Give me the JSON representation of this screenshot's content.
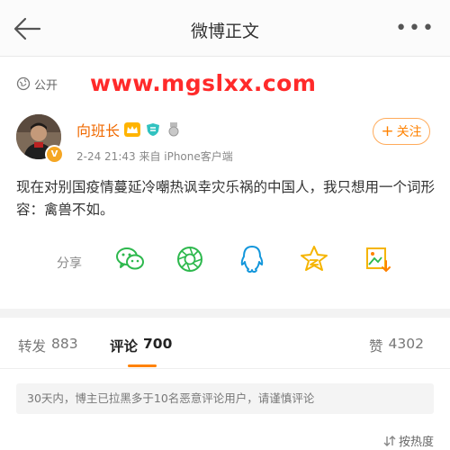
{
  "header": {
    "title": "微博正文",
    "more": "•••"
  },
  "post": {
    "visibility": "公开",
    "watermark": "www.mgslxx.com",
    "author": {
      "name": "向班长",
      "verified_badge": "V"
    },
    "meta": "2-24 21:43  来自 iPhone客户端",
    "follow_label": "关注",
    "text": "现在对别国疫情蔓延冷嘲热讽幸灾乐祸的中国人，我只想用一个词形容：禽兽不如。"
  },
  "share": {
    "label": "分享",
    "icons": [
      "wechat-icon",
      "moments-icon",
      "qq-icon",
      "qzone-icon",
      "image-share-icon"
    ]
  },
  "tabs": {
    "repost": {
      "label": "转发",
      "count": "883"
    },
    "comment": {
      "label": "评论",
      "count": "700"
    },
    "like": {
      "label": "赞",
      "count": "4302"
    }
  },
  "notice": "30天内，博主已拉黑多于10名恶意评论用户，请谨慎评论",
  "sort_label": "按热度",
  "colors": {
    "accent": "#ff8200",
    "username": "#f06900",
    "watermark": "#ff2a2a",
    "share_green": "#2db84d",
    "qq_blue": "#1296db",
    "qzone_gold": "#f5b400"
  }
}
